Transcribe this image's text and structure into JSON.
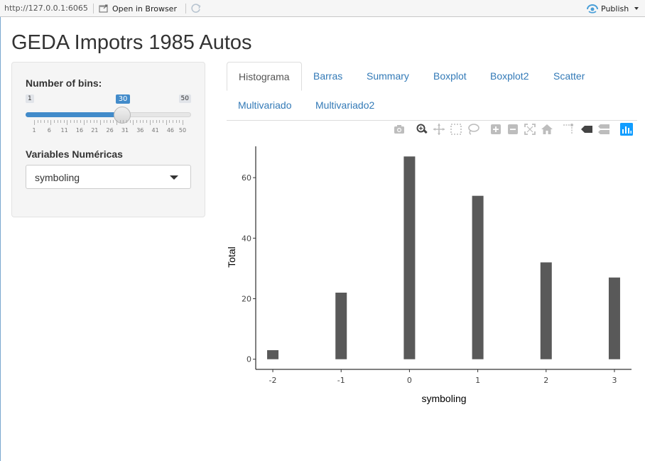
{
  "viewer": {
    "url": "http://127.0.0.1:6065",
    "open_browser": "Open in Browser",
    "publish": "Publish"
  },
  "app": {
    "title": "GEDA Impotrs 1985 Autos"
  },
  "sidebar": {
    "bins_label": "Number of bins:",
    "bins": {
      "min": "1",
      "max": "50",
      "value": "30",
      "value_num": 30,
      "min_num": 1,
      "max_num": 50,
      "tick_labels": [
        "1",
        "6",
        "11",
        "16",
        "21",
        "26",
        "31",
        "36",
        "41",
        "46",
        "50"
      ]
    },
    "vars_label": "Variables Numéricas",
    "vars_selected": "symboling"
  },
  "tabs": [
    "Histograma",
    "Barras",
    "Summary",
    "Boxplot",
    "Boxplot2",
    "Scatter",
    "Multivariado",
    "Multivariado2"
  ],
  "active_tab": "Histograma",
  "modebar": [
    "camera-icon",
    "zoom-icon",
    "pan-icon",
    "box-select-icon",
    "lasso-icon",
    "zoom-in-icon",
    "zoom-out-icon",
    "autoscale-icon",
    "home-icon",
    "spike-lines-icon",
    "hover-closest-icon",
    "hover-compare-icon",
    "plotly-logo-icon"
  ],
  "colors": {
    "bar": "#595959",
    "accent": "#428bca",
    "link": "#337ab7"
  },
  "chart_data": {
    "type": "bar",
    "categories": [
      "-2",
      "-1",
      "0",
      "1",
      "2",
      "3"
    ],
    "x": [
      -2,
      -1,
      0,
      1,
      2,
      3
    ],
    "values": [
      3,
      22,
      67,
      54,
      32,
      27
    ],
    "xlabel": "symboling",
    "ylabel": "Total",
    "xlim": [
      -2.25,
      3.25
    ],
    "ylim": [
      -3.35,
      70.35
    ],
    "yticks": [
      0,
      20,
      40,
      60
    ],
    "xticks": [
      -2,
      -1,
      0,
      1,
      2,
      3
    ],
    "grid": false
  }
}
